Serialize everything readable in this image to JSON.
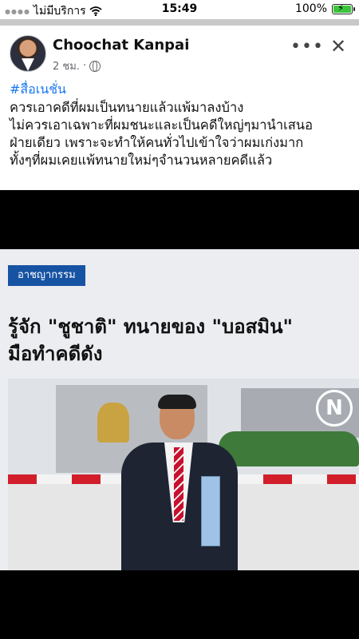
{
  "status_bar": {
    "carrier": "ไม่มีบริการ",
    "time": "15:49",
    "battery": "100%",
    "battery_level": 1.0,
    "icons": [
      "signal-dots-icon",
      "wifi-icon",
      "battery-charging-icon"
    ]
  },
  "post": {
    "author": "Choochat Kanpai",
    "time_ago": "2 ชม.",
    "separator": "·",
    "privacy_icon": "globe-icon",
    "more_label": "•••",
    "close_label": "✕",
    "hashtag": "#สื่อเนชั่น",
    "text_lines": [
      "ควรเอาคดีที่ผมเป็นทนายแล้วแพ้มาลงบ้าง",
      "ไม่ควรเอาเฉพาะที่ผมชนะและเป็นคดีใหญ่ๆมานำเสนอ",
      "ฝ่ายเดียว เพราะจะทำให้คนทั่วไปเข้าใจว่าผมเก่งมาก",
      "ทั้งๆที่ผมเคยแพ้ทนายใหม่ๆจำนวนหลายคดีแล้ว"
    ]
  },
  "preview": {
    "category": "อาชญากรรม",
    "headline_lines": [
      "รู้จัก \"ชูชาติ\" ทนายของ \"บอสมิน\"",
      "มือทำคดีดัง"
    ],
    "logo_letter": "N"
  },
  "colors": {
    "hashtag": "#1877f2",
    "category_bg": "#1753a3",
    "battery_fill": "#3cc53c",
    "background": "#000000"
  }
}
